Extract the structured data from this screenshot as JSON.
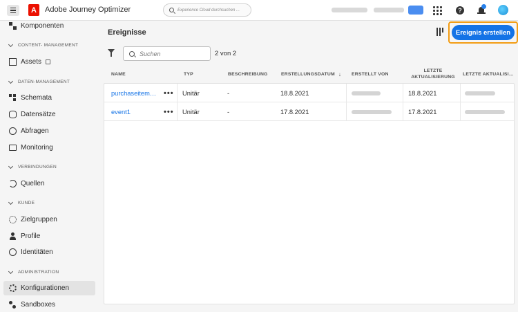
{
  "topbar": {
    "app_title": "Adobe Journey Optimizer",
    "logo_text": "A",
    "search_placeholder": "Experience Cloud durchsuchen ...",
    "help_glyph": "?"
  },
  "sidebar": {
    "items_top": [
      {
        "label": "Komponenten",
        "icon": "blocks-icon"
      }
    ],
    "sections": [
      {
        "heading": "CONTENT- MANAGEMENT",
        "items": [
          {
            "label": "Assets",
            "icon": "assets-icon",
            "external": true
          }
        ]
      },
      {
        "heading": "DATEN-MANAGEMENT",
        "items": [
          {
            "label": "Schemata",
            "icon": "schema-icon"
          },
          {
            "label": "Datensätze",
            "icon": "database-icon"
          },
          {
            "label": "Abfragen",
            "icon": "query-icon"
          },
          {
            "label": "Monitoring",
            "icon": "monitor-icon"
          }
        ]
      },
      {
        "heading": "VERBINDUNGEN",
        "items": [
          {
            "label": "Quellen",
            "icon": "source-icon"
          }
        ]
      },
      {
        "heading": "KUNDE",
        "items": [
          {
            "label": "Zielgruppen",
            "icon": "audience-icon"
          },
          {
            "label": "Profile",
            "icon": "profile-icon"
          },
          {
            "label": "Identitäten",
            "icon": "identity-icon"
          }
        ]
      },
      {
        "heading": "ADMINISTRATION",
        "items": [
          {
            "label": "Konfigurationen",
            "icon": "gear-icon",
            "active": true
          },
          {
            "label": "Sandboxes",
            "icon": "sandbox-icon"
          }
        ]
      }
    ]
  },
  "main": {
    "title": "Ereignisse",
    "create_button": "Ereignis erstellen",
    "search_placeholder": "Suchen",
    "count": "2 von 2",
    "columns": [
      "NAME",
      "TYP",
      "BESCHREIBUNG",
      "ERSTELLUNGSDATUM",
      "ERSTELLT VON",
      "LETZTE AKTUALISIERUNG",
      "LETZTE AKTUALISI…"
    ],
    "sort_column": "ERSTELLUNGSDATUM",
    "sort_direction": "descending",
    "rows": [
      {
        "name": "purchaseitem…",
        "actions": "•••",
        "type": "Unitär",
        "description": "-",
        "created": "18.8.2021",
        "updated": "18.8.2021"
      },
      {
        "name": "event1",
        "actions": "•••",
        "type": "Unitär",
        "description": "-",
        "created": "17.8.2021",
        "updated": "17.8.2021"
      }
    ]
  },
  "colors": {
    "accent": "#1473e6",
    "highlight_border": "#f39c12",
    "adobe_red": "#eb1000"
  }
}
